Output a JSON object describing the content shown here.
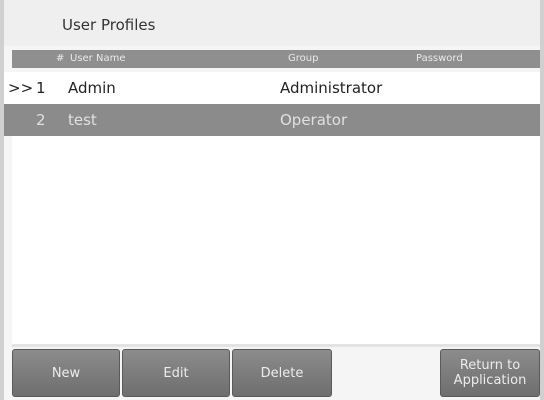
{
  "screen": {
    "title": "User Profiles"
  },
  "table": {
    "columns": {
      "num": "#",
      "user_name": "User Name",
      "group": "Group",
      "password": "Password"
    },
    "rows": [
      {
        "marker": ">>",
        "num": "1",
        "user_name": "Admin",
        "group": "Administrator",
        "password": "",
        "selected": false
      },
      {
        "marker": "",
        "num": "2",
        "user_name": "test",
        "group": "Operator",
        "password": "",
        "selected": true
      }
    ]
  },
  "buttons": {
    "new": "New",
    "edit": "Edit",
    "delete": "Delete",
    "return": "Return to Application"
  },
  "colors": {
    "header_bg": "#8f8f8f",
    "selected_row_bg": "#8b8b8b",
    "button_bg": "#7d7d7d"
  }
}
